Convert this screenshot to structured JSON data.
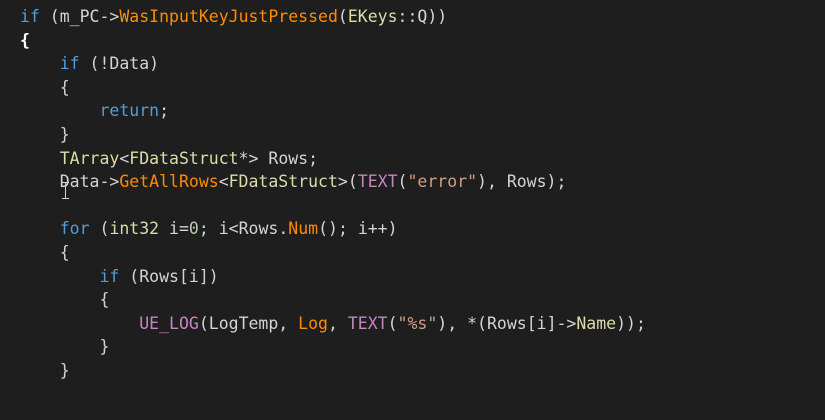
{
  "editor": {
    "lines": [
      [
        {
          "t": "if",
          "c": "kw"
        },
        {
          "t": " (m_PC->",
          "c": ""
        },
        {
          "t": "WasInputKeyJustPressed",
          "c": "fn"
        },
        {
          "t": "(",
          "c": ""
        },
        {
          "t": "EKeys",
          "c": "ty"
        },
        {
          "t": "::Q))",
          "c": ""
        }
      ],
      [
        {
          "t": "{",
          "c": "brace-bold"
        }
      ],
      [
        {
          "t": "    ",
          "c": ""
        },
        {
          "t": "if",
          "c": "kw"
        },
        {
          "t": " (!Data)",
          "c": ""
        }
      ],
      [
        {
          "t": "    {",
          "c": ""
        }
      ],
      [
        {
          "t": "        ",
          "c": ""
        },
        {
          "t": "return",
          "c": "kw"
        },
        {
          "t": ";",
          "c": ""
        }
      ],
      [
        {
          "t": "    }",
          "c": ""
        }
      ],
      [
        {
          "t": "    ",
          "c": ""
        },
        {
          "t": "TArray",
          "c": "ty"
        },
        {
          "t": "<",
          "c": ""
        },
        {
          "t": "FDataStruct",
          "c": "ty"
        },
        {
          "t": "*> Rows;",
          "c": ""
        }
      ],
      [
        {
          "t": "    Data->",
          "c": ""
        },
        {
          "t": "GetAllRows",
          "c": "fn"
        },
        {
          "t": "<",
          "c": ""
        },
        {
          "t": "FDataStruct",
          "c": "ty"
        },
        {
          "t": ">(",
          "c": ""
        },
        {
          "t": "TEXT",
          "c": "mac"
        },
        {
          "t": "(",
          "c": ""
        },
        {
          "t": "\"error\"",
          "c": "str"
        },
        {
          "t": "), Rows);",
          "c": ""
        }
      ],
      [
        {
          "t": "",
          "c": ""
        }
      ],
      [
        {
          "t": "    ",
          "c": ""
        },
        {
          "t": "for",
          "c": "kw"
        },
        {
          "t": " (",
          "c": ""
        },
        {
          "t": "int32",
          "c": "ty"
        },
        {
          "t": " i=",
          "c": ""
        },
        {
          "t": "0",
          "c": "num"
        },
        {
          "t": "; i<Rows.",
          "c": ""
        },
        {
          "t": "Num",
          "c": "fn"
        },
        {
          "t": "(); i++)",
          "c": ""
        }
      ],
      [
        {
          "t": "    {",
          "c": ""
        }
      ],
      [
        {
          "t": "        ",
          "c": ""
        },
        {
          "t": "if",
          "c": "kw"
        },
        {
          "t": " (Rows[i])",
          "c": ""
        }
      ],
      [
        {
          "t": "        {",
          "c": ""
        }
      ],
      [
        {
          "t": "            ",
          "c": ""
        },
        {
          "t": "UE_LOG",
          "c": "mac"
        },
        {
          "t": "(LogTemp, ",
          "c": ""
        },
        {
          "t": "Log",
          "c": "fn"
        },
        {
          "t": ", ",
          "c": ""
        },
        {
          "t": "TEXT",
          "c": "mac"
        },
        {
          "t": "(",
          "c": ""
        },
        {
          "t": "\"%s\"",
          "c": "str"
        },
        {
          "t": "), *(Rows[i]->",
          "c": ""
        },
        {
          "t": "Name",
          "c": "ty"
        },
        {
          "t": "));",
          "c": ""
        }
      ],
      [
        {
          "t": "        }",
          "c": ""
        }
      ],
      [
        {
          "t": "    }",
          "c": ""
        }
      ]
    ]
  }
}
